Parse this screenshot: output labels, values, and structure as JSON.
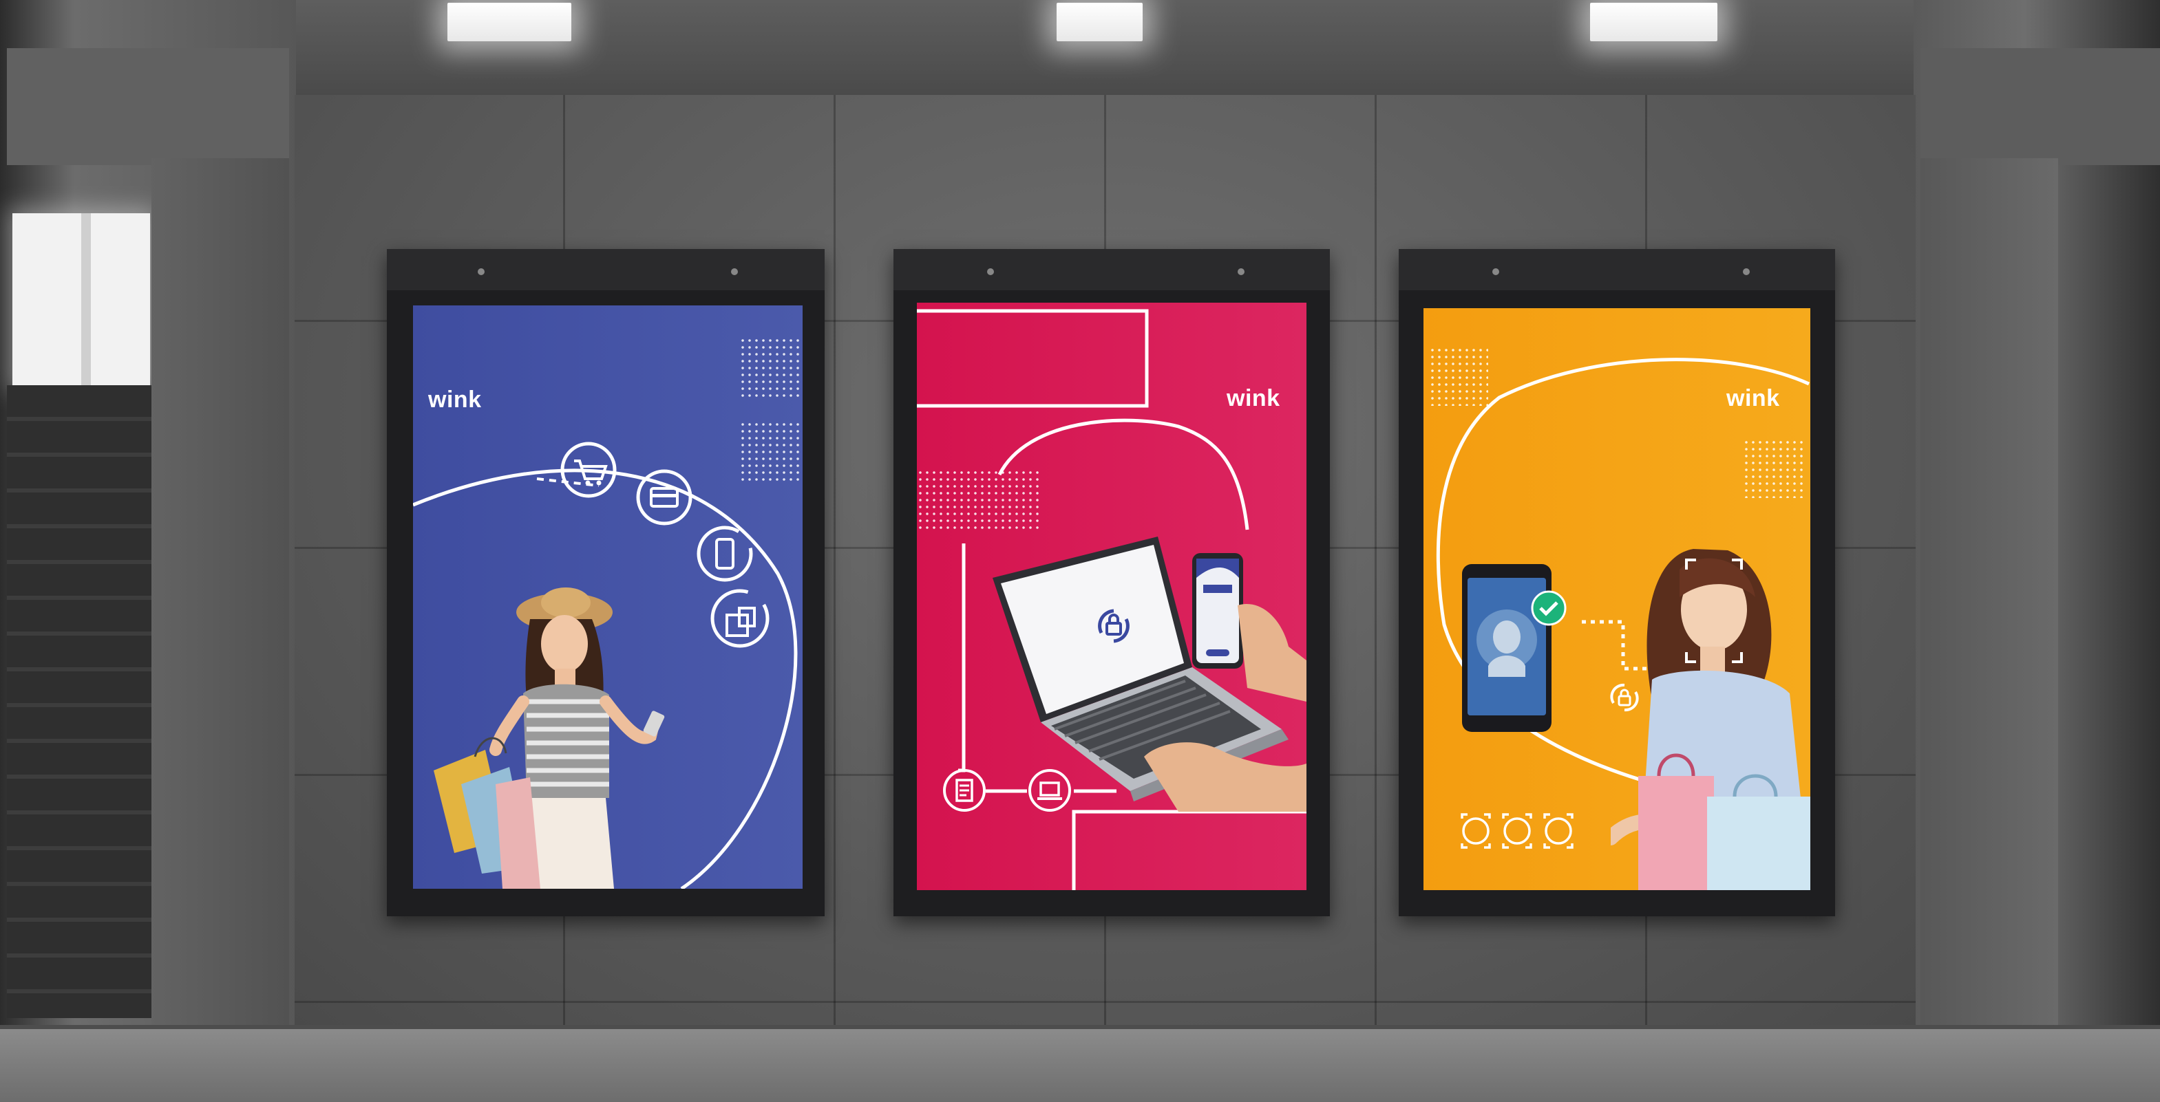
{
  "posters": [
    {
      "brand": "wink",
      "background": "#4654a3",
      "theme": "shopping",
      "icons": [
        "shopping-cart-icon",
        "card-icon",
        "phone-icon",
        "shopping-bag-icon"
      ]
    },
    {
      "brand": "wink",
      "background": "#d81a54",
      "theme": "secure-login",
      "icons": [
        "lock-refresh-icon",
        "document-icon",
        "laptop-icon"
      ]
    },
    {
      "brand": "wink",
      "background": "#f5a311",
      "theme": "face-verification",
      "icons": [
        "face-scan-icon",
        "lock-refresh-icon",
        "face-id-icon"
      ]
    }
  ],
  "colors": {
    "wall": "#5b5b5b",
    "frame": "#1e1e20",
    "accent_white": "#ffffff"
  }
}
